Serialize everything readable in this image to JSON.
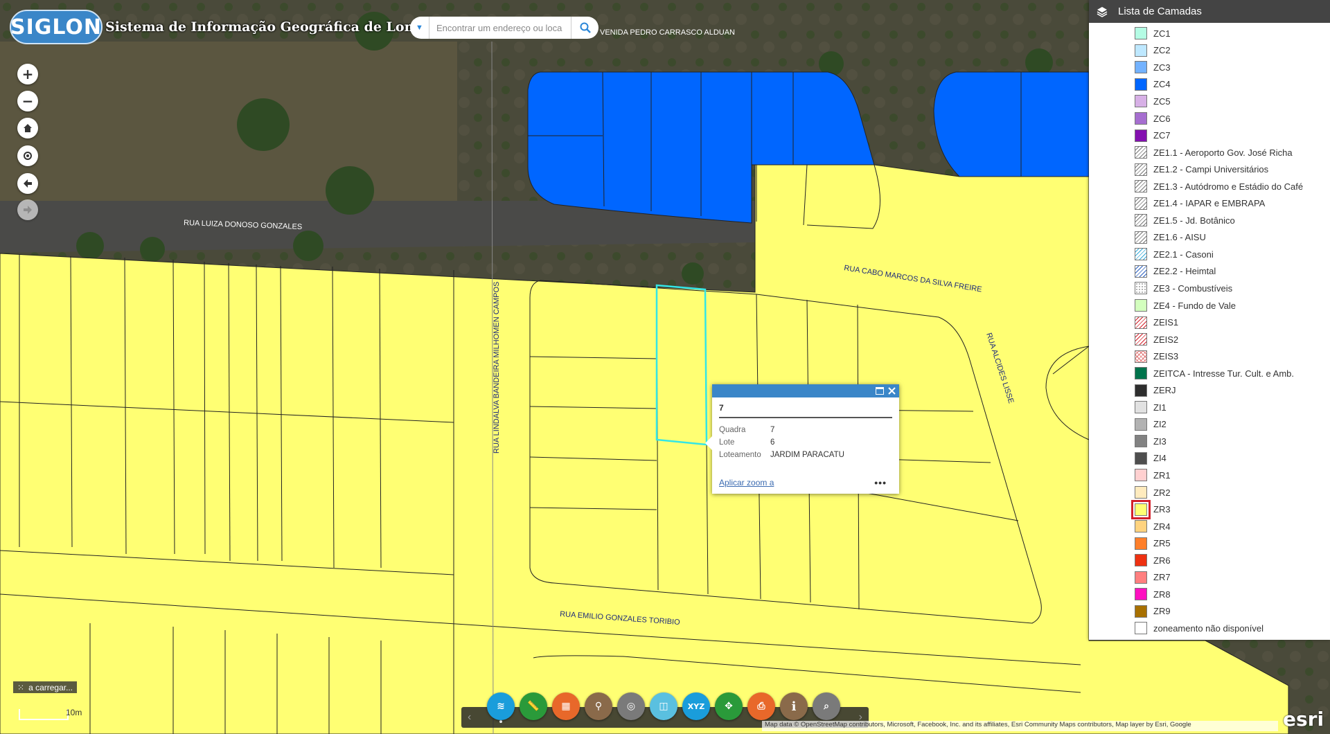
{
  "header": {
    "logo_text": "SIGLON",
    "title": "Sistema de Informação Geográfica de Londrina",
    "search_placeholder": "Encontrar um endereço ou loca"
  },
  "map": {
    "streets": {
      "avenida": "VENIDA PEDRO CARRASCO ALDUAN",
      "luiza": "RUA LUIZA DONOSO GONZALES",
      "lindalva": "RUA LINDALVA BANDEIRA MILHOMEN CAMPOS",
      "cabo": "RUA CABO MARCOS DA SILVA FREIRE",
      "alcides": "RUA ALCIDES LISSE",
      "emilio": "RUA EMILIO GONZALES TORIBIO"
    },
    "loading_text": "a carregar...",
    "scale_label": "10m",
    "attribution": "Map data © OpenStreetMap contributors, Microsoft, Facebook, Inc. and its affiliates, Esri Community Maps contributors, Map layer by Esri, Google",
    "esri_logo": "esri",
    "zone_colors": {
      "zr3": "#ffff73",
      "zc4": "#0066ff",
      "selected_outline": "#33e6e6"
    }
  },
  "popup": {
    "title": "7",
    "fields": [
      {
        "key": "Quadra",
        "value": "7"
      },
      {
        "key": "Lote",
        "value": "6"
      },
      {
        "key": "Loteamento",
        "value": "JARDIM PARACATU"
      }
    ],
    "zoom_link": "Aplicar zoom a",
    "more": "•••"
  },
  "layer_panel": {
    "title": "Lista de Camadas",
    "items": [
      {
        "label": "ZC1",
        "color": "#b4fce4"
      },
      {
        "label": "ZC2",
        "color": "#bee8ff"
      },
      {
        "label": "ZC3",
        "color": "#73b2ff"
      },
      {
        "label": "ZC4",
        "color": "#0066ff"
      },
      {
        "label": "ZC5",
        "color": "#d7b0e6"
      },
      {
        "label": "ZC6",
        "color": "#a66ed0"
      },
      {
        "label": "ZC7",
        "color": "#8410b0"
      },
      {
        "label": "ZE1.1 - Aeroporto Gov. José Richa",
        "color": "hatch-gray"
      },
      {
        "label": "ZE1.2 - Campi Universitários",
        "color": "hatch-gray"
      },
      {
        "label": "ZE1.3 - Autódromo e Estádio do Café",
        "color": "hatch-gray"
      },
      {
        "label": "ZE1.4 - IAPAR e EMBRAPA",
        "color": "hatch-gray"
      },
      {
        "label": "ZE1.5 - Jd. Botânico",
        "color": "hatch-gray"
      },
      {
        "label": "ZE1.6 - AISU",
        "color": "hatch-gray"
      },
      {
        "label": "ZE2.1 - Casoni",
        "color": "hatch-cyan"
      },
      {
        "label": "ZE2.2 - Heimtal",
        "color": "hatch-blue"
      },
      {
        "label": "ZE3 - Combustíveis",
        "color": "dots"
      },
      {
        "label": "ZE4 - Fundo de Vale",
        "color": "#d3ffbe"
      },
      {
        "label": "ZEIS1",
        "color": "hatch-red"
      },
      {
        "label": "ZEIS2",
        "color": "hatch-red"
      },
      {
        "label": "ZEIS3",
        "color": "cross-red"
      },
      {
        "label": "ZEITCA - Intresse Tur. Cult. e Amb.",
        "color": "#00734c"
      },
      {
        "label": "ZERJ",
        "color": "#2e2e2e"
      },
      {
        "label": "ZI1",
        "color": "#e1e1e1"
      },
      {
        "label": "ZI2",
        "color": "#b2b2b2"
      },
      {
        "label": "ZI3",
        "color": "#828282"
      },
      {
        "label": "ZI4",
        "color": "#4e4e4e"
      },
      {
        "label": "ZR1",
        "color": "#ffd0d0"
      },
      {
        "label": "ZR2",
        "color": "#ffebbe"
      },
      {
        "label": "ZR3",
        "color": "#ffff73",
        "selected": true
      },
      {
        "label": "ZR4",
        "color": "#ffd37f"
      },
      {
        "label": "ZR5",
        "color": "#ff7f2a"
      },
      {
        "label": "ZR6",
        "color": "#ee3111"
      },
      {
        "label": "ZR7",
        "color": "#ff7f7f"
      },
      {
        "label": "ZR8",
        "color": "#ff10c0"
      },
      {
        "label": "ZR9",
        "color": "#a87000"
      },
      {
        "label": "zoneamento não disponível",
        "color": "#ffffff"
      }
    ]
  },
  "toolbar": {
    "buttons": [
      {
        "name": "layers-icon",
        "color": "#1a9ddb"
      },
      {
        "name": "ruler-icon",
        "color": "#2a9a3a"
      },
      {
        "name": "grid-icon",
        "color": "#e8682a"
      },
      {
        "name": "filter-icon",
        "color": "#8a6a4a"
      },
      {
        "name": "location-icon",
        "color": "#7a7a7a"
      },
      {
        "name": "compare-icon",
        "color": "#5ac0e0"
      },
      {
        "name": "xyz-icon",
        "color": "#1a9ddb"
      },
      {
        "name": "share-icon",
        "color": "#2a9a3a"
      },
      {
        "name": "print-icon",
        "color": "#e8682a"
      },
      {
        "name": "info-icon",
        "color": "#8a6a4a"
      },
      {
        "name": "query-icon",
        "color": "#7a7a7a"
      }
    ],
    "xyz_label": "XYZ",
    "info_label": "i"
  }
}
